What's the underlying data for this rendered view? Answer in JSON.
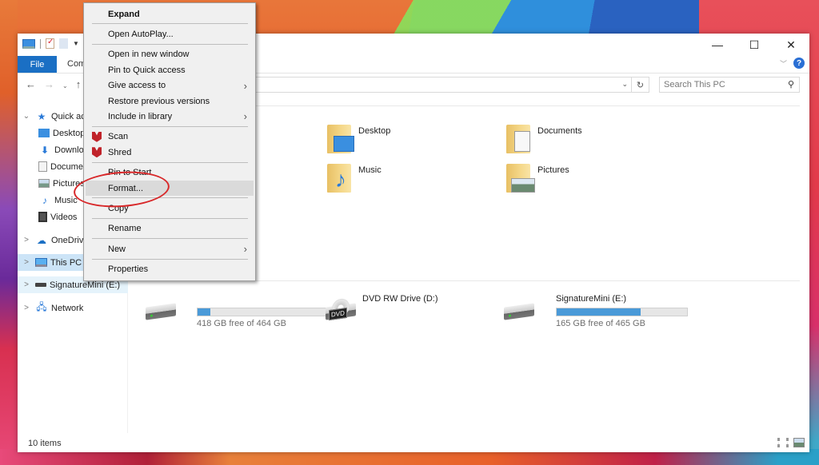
{
  "window": {
    "title_controls": {
      "minimize": "—",
      "maximize": "☐",
      "close": "✕"
    },
    "quick_access_toolbar": [
      "this-pc-icon",
      "properties-icon",
      "new-folder-icon",
      "customize-dropdown"
    ],
    "ribbon": {
      "tabs": [
        {
          "label": "File",
          "active": true
        },
        {
          "label": "Computer"
        }
      ],
      "help_label": "?"
    },
    "nav": {
      "back": "←",
      "forward": "→",
      "recent": "⌄",
      "up": "↑"
    },
    "address": {
      "value": "",
      "dropdown": "⌄",
      "refresh": "↻"
    },
    "search": {
      "placeholder": "Search This PC",
      "icon": "⌕"
    }
  },
  "sidebar": {
    "items": [
      {
        "label": "Quick access",
        "icon": "star-icon",
        "expander": "⌄",
        "level": 0
      },
      {
        "label": "Desktop",
        "icon": "desktop-icon",
        "level": 1
      },
      {
        "label": "Downloads",
        "icon": "downloads-icon",
        "level": 1
      },
      {
        "label": "Documents",
        "icon": "documents-icon",
        "level": 1
      },
      {
        "label": "Pictures",
        "icon": "pictures-icon",
        "level": 1
      },
      {
        "label": "Music",
        "icon": "music-icon",
        "level": 1
      },
      {
        "label": "Videos",
        "icon": "videos-icon",
        "level": 1
      },
      {
        "label": "OneDrive",
        "icon": "cloud-icon",
        "expander": ">",
        "level": 0
      },
      {
        "label": "This PC",
        "icon": "pc-icon",
        "expander": ">",
        "level": 0,
        "selected": true
      },
      {
        "label": "SignatureMini (E:)",
        "icon": "drive-icon",
        "expander": ">",
        "level": 0,
        "hover": true
      },
      {
        "label": "Network",
        "icon": "network-icon",
        "expander": ">",
        "level": 0
      }
    ]
  },
  "content": {
    "folders": [
      {
        "name": "Desktop",
        "icon": "desktop-folder-icon"
      },
      {
        "name": "Documents",
        "icon": "documents-folder-icon"
      },
      {
        "name": "Music",
        "icon": "music-folder-icon"
      },
      {
        "name": "Pictures",
        "icon": "pictures-folder-icon"
      }
    ],
    "drives": [
      {
        "name": "",
        "free_text": "418 GB free of 464 GB",
        "used_fraction": 0.099,
        "icon": "hard-drive-icon"
      },
      {
        "name": "DVD RW Drive (D:)",
        "free_text": "",
        "icon": "dvd-drive-icon",
        "dvd_label": "DVD"
      },
      {
        "name": "SignatureMini (E:)",
        "free_text": "165 GB free of 465 GB",
        "used_fraction": 0.645,
        "icon": "usb-drive-icon"
      }
    ]
  },
  "status": {
    "items_text": "10 items"
  },
  "context_menu": {
    "items": [
      {
        "label": "Expand",
        "bold": true
      },
      {
        "sep": true
      },
      {
        "label": "Open AutoPlay..."
      },
      {
        "sep": true
      },
      {
        "label": "Open in new window"
      },
      {
        "label": "Pin to Quick access"
      },
      {
        "label": "Give access to",
        "submenu": true
      },
      {
        "label": "Restore previous versions"
      },
      {
        "label": "Include in library",
        "submenu": true
      },
      {
        "sep": true
      },
      {
        "label": "Scan",
        "icon": "mcafee-icon"
      },
      {
        "label": "Shred",
        "icon": "mcafee-icon"
      },
      {
        "sep": true
      },
      {
        "label": "Pin to Start"
      },
      {
        "label": "Format...",
        "highlighted": true
      },
      {
        "sep": true
      },
      {
        "label": "Copy"
      },
      {
        "sep": true
      },
      {
        "label": "Rename"
      },
      {
        "sep": true
      },
      {
        "label": "New",
        "submenu": true
      },
      {
        "sep": true
      },
      {
        "label": "Properties"
      }
    ],
    "submenu_arrow": "›"
  },
  "colors": {
    "accent": "#1a6fc4",
    "selection": "#cce4f7",
    "bar_fill": "#4a9ad8",
    "annotation": "#d8282a",
    "mcafee": "#c0232a"
  }
}
